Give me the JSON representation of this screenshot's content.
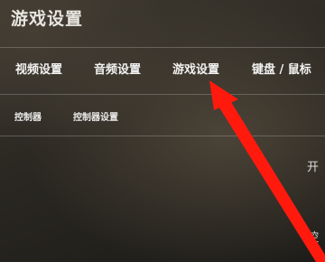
{
  "header": {
    "title": "游戏设置"
  },
  "tabs": [
    {
      "label": "视频设置"
    },
    {
      "label": "音频设置"
    },
    {
      "label": "游戏设置"
    },
    {
      "label": "键盘 / 鼠标"
    }
  ],
  "subtabs": [
    {
      "label": "控制器"
    },
    {
      "label": "控制器设置"
    }
  ],
  "settings": [
    {
      "label": "开"
    },
    {
      "label": "控"
    }
  ],
  "annotation": {
    "color": "#ff1a0d"
  }
}
